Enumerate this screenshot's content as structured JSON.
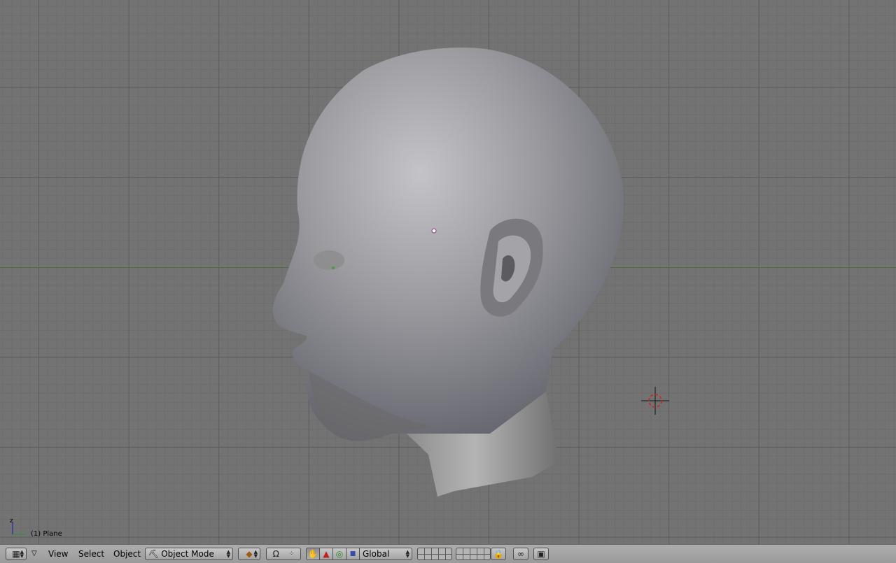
{
  "viewport": {
    "object_label": "(1) Plane",
    "axis_label_z": "z",
    "x_axis_color": "#5e8a4e",
    "mesh_color": "#8e8e92",
    "cursor_color": "#d02020"
  },
  "header": {
    "menus": {
      "view": "View",
      "select": "Select",
      "object": "Object"
    },
    "mode_selector": {
      "value": "Object Mode"
    },
    "orientation_selector": {
      "value": "Global"
    },
    "icons": [
      "viewport-grid-icon",
      "collapse-triangle-icon",
      "draw-type-icon",
      "pivot-icon",
      "translate-widget-icon",
      "rotate-widget-icon",
      "scale-widget-icon",
      "layers-icon",
      "lock-icon",
      "link-icon",
      "render-icon"
    ]
  }
}
